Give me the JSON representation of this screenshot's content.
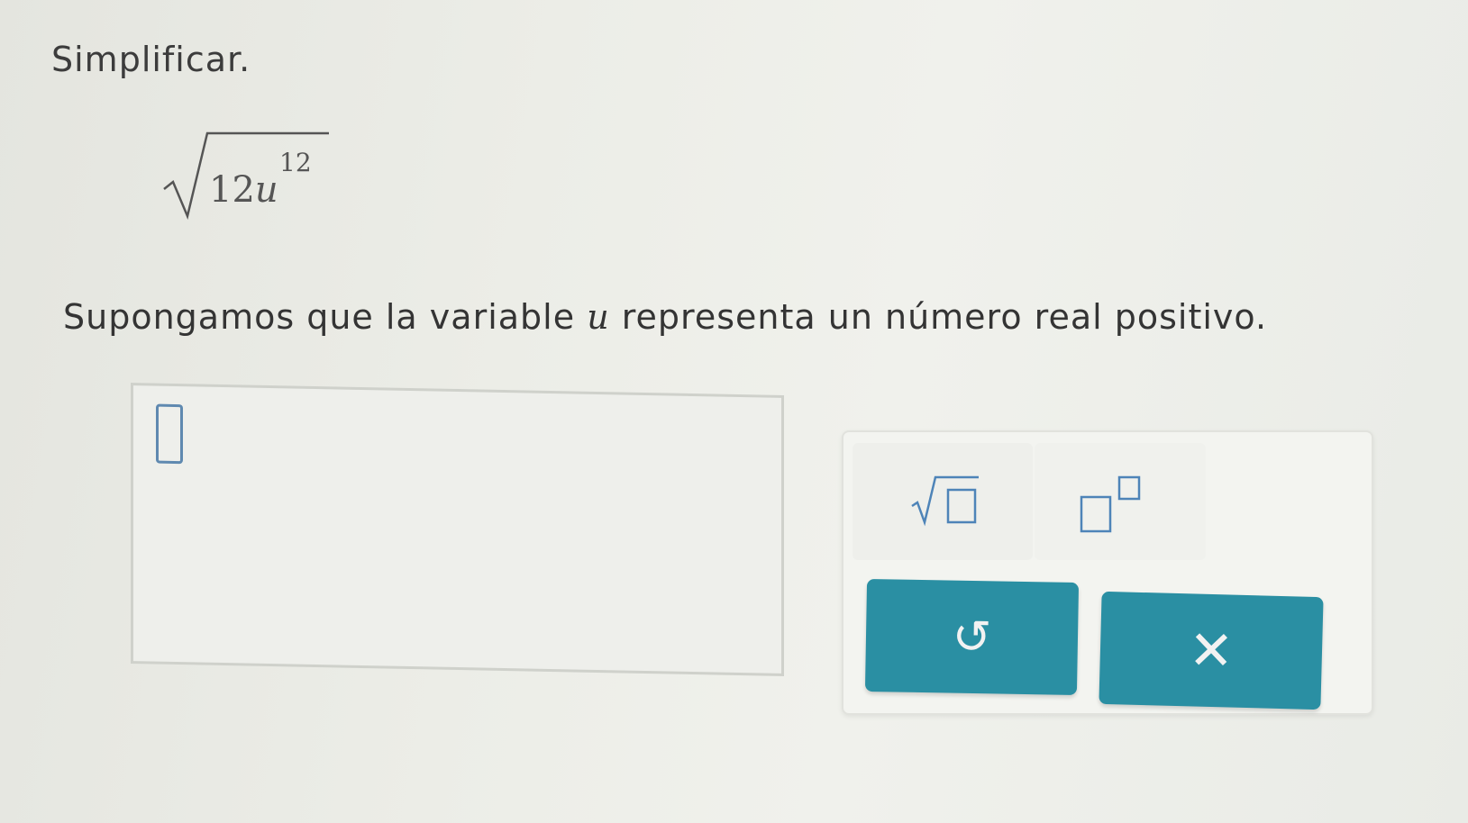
{
  "prompt": {
    "instruction": "Simplificar.",
    "expression": {
      "coefficient": "12",
      "variable": "u",
      "exponent": "12"
    },
    "assumption_before": "Supongamos que la variable ",
    "assumption_var": "u",
    "assumption_after": " representa un número real positivo."
  },
  "answer": {
    "value": ""
  },
  "keypad": {
    "keys": [
      {
        "id": "sqrt",
        "icon": "square-root-icon"
      },
      {
        "id": "power",
        "icon": "exponent-icon"
      }
    ],
    "undo": {
      "icon": "undo-icon",
      "glyph": "↺"
    },
    "clear": {
      "icon": "close-icon",
      "glyph": "✕"
    }
  },
  "colors": {
    "button": "#2a8fa3",
    "cursor": "#5f89b0"
  }
}
